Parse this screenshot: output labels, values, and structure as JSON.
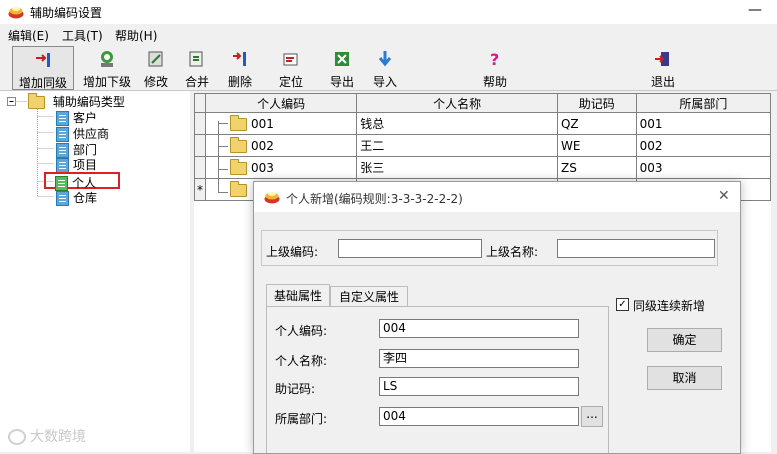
{
  "window": {
    "title": "辅助编码设置",
    "minimize": "—"
  },
  "menu": [
    "编辑(E)",
    "工具(T)",
    "帮助(H)"
  ],
  "toolbar": {
    "add_sibling": "增加同级",
    "add_child": "增加下级",
    "modify": "修改",
    "merge": "合并",
    "delete": "删除",
    "locate": "定位",
    "export": "导出",
    "import": "导入",
    "help": "帮助",
    "exit": "退出"
  },
  "tree": {
    "root": "辅助编码类型",
    "items": [
      "客户",
      "供应商",
      "部门",
      "项目",
      "个人",
      "仓库"
    ],
    "selected": "个人"
  },
  "grid": {
    "columns": [
      "个人编码",
      "个人名称",
      "助记码",
      "所属部门"
    ],
    "rows": [
      {
        "code": "001",
        "name": "钱总",
        "mnemonic": "QZ",
        "dept": "001"
      },
      {
        "code": "002",
        "name": "王二",
        "mnemonic": "WE",
        "dept": "002"
      },
      {
        "code": "003",
        "name": "张三",
        "mnemonic": "ZS",
        "dept": "003"
      }
    ],
    "new_row_marker": "*"
  },
  "dialog": {
    "title": "个人新增(编码规则:3-3-3-2-2-2)",
    "parent_code_label": "上级编码:",
    "parent_code_value": "",
    "parent_name_label": "上级名称:",
    "parent_name_value": "",
    "tabs": [
      "基础属性",
      "自定义属性"
    ],
    "active_tab": "基础属性",
    "fields": {
      "code_label": "个人编码:",
      "code_value": "004",
      "name_label": "个人名称:",
      "name_value": "李四",
      "mnemonic_label": "助记码:",
      "mnemonic_value": "LS",
      "dept_label": "所属部门:",
      "dept_value": "004",
      "browse_label": "..."
    },
    "continuous_add_label": "同级连续新增",
    "continuous_add_checked": true,
    "ok_label": "确定",
    "cancel_label": "取消",
    "close_glyph": "✕",
    "checkmark_glyph": "✓"
  },
  "watermark": "大数跨境",
  "colors": {
    "selection_border": "#e02020",
    "folder": "#f2d26a",
    "doc": "#5aa7d8"
  }
}
